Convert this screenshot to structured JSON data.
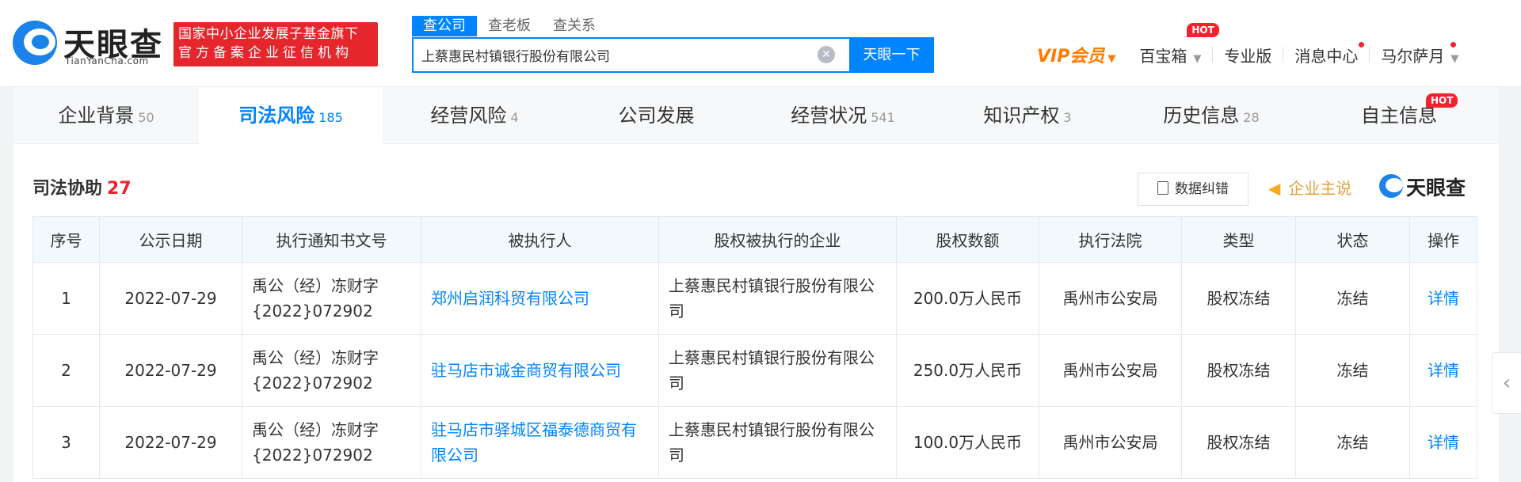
{
  "header": {
    "logo_text": "天眼查",
    "logo_sub": "TianYanCha.com",
    "slogan_line1": "国家中小企业发展子基金旗下",
    "slogan_line2": "官方备案企业征信机构",
    "search_tabs": [
      "查公司",
      "查老板",
      "查关系"
    ],
    "search_value": "上蔡惠民村镇银行股份有限公司",
    "search_button": "天眼一下",
    "nav": {
      "vip": "VIP会员",
      "treasure": "百宝箱",
      "hot": "HOT",
      "pro": "专业版",
      "messages": "消息中心",
      "user": "马尔萨月"
    }
  },
  "tabs": [
    {
      "label": "企业背景",
      "count": "50"
    },
    {
      "label": "司法风险",
      "count": "185"
    },
    {
      "label": "经营风险",
      "count": "4"
    },
    {
      "label": "公司发展",
      "count": ""
    },
    {
      "label": "经营状况",
      "count": "541"
    },
    {
      "label": "知识产权",
      "count": "3"
    },
    {
      "label": "历史信息",
      "count": "28"
    },
    {
      "label": "自主信息",
      "count": ""
    }
  ],
  "tab_hot": "HOT",
  "section": {
    "title": "司法协助",
    "count": "27",
    "fix_button": "数据纠错",
    "claim": "企业主说",
    "brand": "天眼查"
  },
  "table": {
    "headers": [
      "序号",
      "公示日期",
      "执行通知书文号",
      "被执行人",
      "股权被执行的企业",
      "股权数额",
      "执行法院",
      "类型",
      "状态",
      "操作"
    ],
    "rows": [
      {
        "no": "1",
        "date": "2022-07-29",
        "doc": "禹公（经）冻财字{2022}072902",
        "subject": "郑州启润科贸有限公司",
        "company": "上蔡惠民村镇银行股份有限公司",
        "amount": "200.0万人民币",
        "court": "禹州市公安局",
        "type": "股权冻结",
        "status": "冻结",
        "action": "详情"
      },
      {
        "no": "2",
        "date": "2022-07-29",
        "doc": "禹公（经）冻财字{2022}072902",
        "subject": "驻马店市诚金商贸有限公司",
        "company": "上蔡惠民村镇银行股份有限公司",
        "amount": "250.0万人民币",
        "court": "禹州市公安局",
        "type": "股权冻结",
        "status": "冻结",
        "action": "详情"
      },
      {
        "no": "3",
        "date": "2022-07-29",
        "doc": "禹公（经）冻财字{2022}072902",
        "subject": "驻马店市驿城区福泰德商贸有限公司",
        "company": "上蔡惠民村镇银行股份有限公司",
        "amount": "100.0万人民币",
        "court": "禹州市公安局",
        "type": "股权冻结",
        "status": "冻结",
        "action": "详情"
      }
    ]
  },
  "colors": {
    "brand_blue": "#0084ff",
    "hot_red": "#f5222d",
    "vip_orange": "#ff7a00",
    "slogan_red": "#e6262d"
  },
  "icons": [
    "tianyancha-logo-icon",
    "clear-icon",
    "caret-down-icon",
    "document-icon",
    "megaphone-icon",
    "chevron-left-icon"
  ]
}
